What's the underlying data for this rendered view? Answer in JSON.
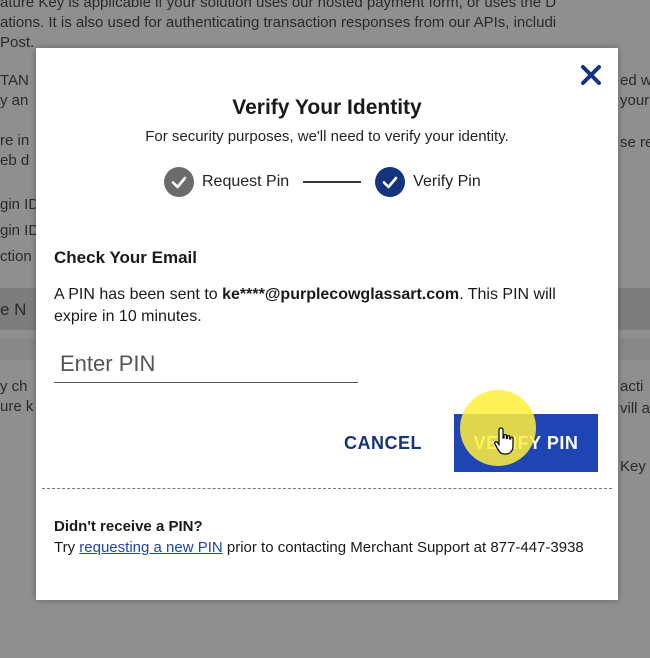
{
  "background": {
    "lines": [
      "ature Key is applicable if your solution uses our hosted payment form, or uses the D",
      "ations. It is also used for authenticating transaction responses from our APIs, includi",
      "Post.",
      "TAN",
      "y an",
      "re in",
      "eb d",
      "gin ID",
      "gin ID",
      "ction",
      "e N",
      "y ch",
      "ure k",
      "ed w",
      "your",
      "se re",
      "acti",
      "vill a",
      "Key"
    ]
  },
  "modal": {
    "title": "Verify Your Identity",
    "subtitle": "For security purposes, we'll need to verify your identity.",
    "steps": [
      {
        "label": "Request Pin",
        "state": "done"
      },
      {
        "label": "Verify Pin",
        "state": "active"
      }
    ],
    "section_title": "Check Your Email",
    "message_prefix": "A PIN has been sent to ",
    "message_email": "ke****@purplecowglassart.com",
    "message_suffix": ". This PIN will expire in 10 minutes.",
    "pin_input": {
      "placeholder": "Enter PIN",
      "value": ""
    },
    "cancel_label": "CANCEL",
    "verify_label": "VERIFY PIN",
    "footer_title": "Didn't receive a PIN?",
    "footer_prefix": "Try ",
    "footer_link": "requesting a new PIN",
    "footer_suffix": " prior to contacting Merchant Support at 877-447-3938"
  },
  "colors": {
    "primary": "#1f44b3",
    "navy": "#14347e",
    "step_done": "#6b6b6b",
    "cursor_highlight": "#fff03c"
  }
}
